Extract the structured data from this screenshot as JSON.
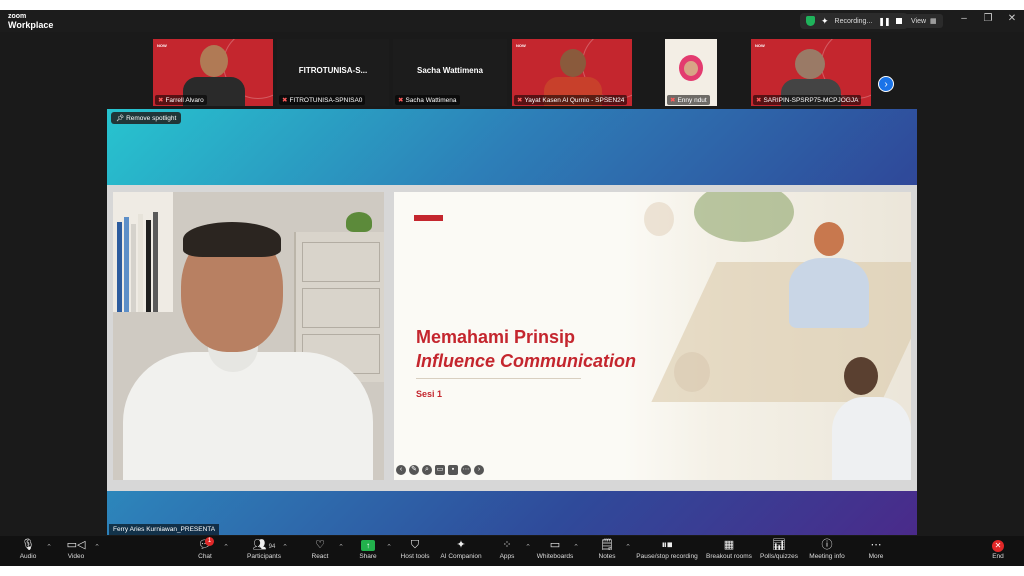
{
  "titlebar": {
    "brand_top": "zoom",
    "brand_bottom": "Workplace",
    "recording_label": "Recording...",
    "view_label": "View"
  },
  "thumbnails": [
    {
      "name": "Farrell Alvaro",
      "type": "video"
    },
    {
      "name": "FITROTUNISA-SPNISA0",
      "big_name": "FITROTUNISA-S...",
      "type": "name"
    },
    {
      "name": "Sacha Wattimena",
      "big_name": "Sacha Wattimena",
      "type": "name"
    },
    {
      "name": "Yayat Kasen Al Qurnio - SPSEN24",
      "type": "video"
    },
    {
      "name": "Enny ndut",
      "type": "video"
    },
    {
      "name": "SARIPIN-SPSRP75-MCPJOGJA",
      "type": "video"
    }
  ],
  "thumb_overlay_text": "NOW",
  "stage": {
    "remove_spotlight_label": "Remove spotlight",
    "speaker_name": "Ferry Aries Kurniawan_PRESENTA"
  },
  "slide": {
    "title_line1": "Memahami Prinsip",
    "title_line2": "Influence Communication",
    "subtitle": "Sesi 1",
    "accent_color": "#c4262e"
  },
  "toolbar": {
    "audio": "Audio",
    "video": "Video",
    "chat": "Chat",
    "chat_badge": "1",
    "participants": "Participants",
    "participants_count": "94",
    "react": "React",
    "share": "Share",
    "host_tools": "Host tools",
    "ai_companion": "AI Companion",
    "apps": "Apps",
    "whiteboards": "Whiteboards",
    "notes": "Notes",
    "pause_stop": "Pause/stop recording",
    "breakout": "Breakout rooms",
    "polls": "Polls/quizzes",
    "meeting_info": "Meeting info",
    "more": "More",
    "end": "End"
  }
}
